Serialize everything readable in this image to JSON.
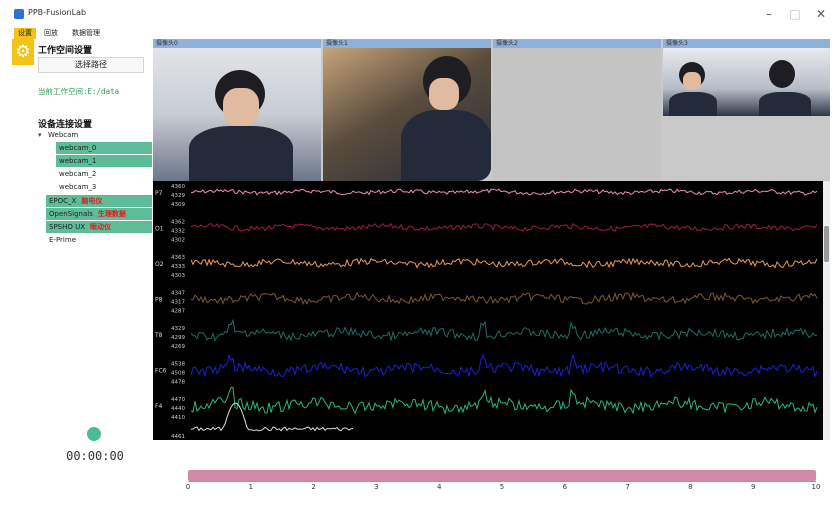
{
  "window": {
    "title": "PPB-FusionLab",
    "controls": [
      "–",
      "□",
      "✕"
    ]
  },
  "menu": [
    "设置",
    "回放",
    "数据管理"
  ],
  "left_panel": {
    "workspace_heading": "工作空间设置",
    "choose_path_button": "选择路径",
    "current_workspace": "当前工作空间:E:/data",
    "device_heading": "设备连接设置",
    "tree_arrow": "▾",
    "webcam_group": "Webcam",
    "webcams": [
      "webcam_0",
      "webcam_1",
      "webcam_2",
      "webcam_3"
    ],
    "devices": [
      {
        "name": "EPOC_X",
        "tag": "脑电仪"
      },
      {
        "name": "OpenSignals",
        "tag": "生理数据"
      },
      {
        "name": "SPSHO UX",
        "tag": "眼动仪"
      },
      {
        "name": "E-Prime",
        "tag": ""
      }
    ],
    "timer": "00:00:00"
  },
  "cameras": [
    {
      "label": "摄像头0"
    },
    {
      "label": "摄像头1"
    },
    {
      "label": "摄像头2"
    },
    {
      "label": "摄像头3"
    }
  ],
  "eeg": {
    "channels": [
      {
        "name": "P7",
        "ticks": [
          "4360",
          "4329",
          "4309"
        ],
        "color": "#ec8fb4"
      },
      {
        "name": "O1",
        "ticks": [
          "4362",
          "4332",
          "4302"
        ],
        "color": "#a01a4a"
      },
      {
        "name": "O2",
        "ticks": [
          "4363",
          "4333",
          "4303"
        ],
        "color": "#ef9a55"
      },
      {
        "name": "P8",
        "ticks": [
          "4347",
          "4317",
          "4287"
        ],
        "color": "#7a5a2e"
      },
      {
        "name": "T8",
        "ticks": [
          "4329",
          "4299",
          "4269"
        ],
        "color": "#1d6e60"
      },
      {
        "name": "FC6",
        "ticks": [
          "4538",
          "4508",
          "4478"
        ],
        "color": "#1a22d4"
      },
      {
        "name": "F4",
        "ticks": [
          "4470",
          "4440",
          "4410"
        ],
        "color": "#27b58c"
      }
    ],
    "last_tick": "4461"
  },
  "timeline": {
    "ticks": [
      "0",
      "1",
      "2",
      "3",
      "4",
      "5",
      "6",
      "7",
      "8",
      "9",
      "10"
    ],
    "bar_color": "#d08aa8"
  }
}
